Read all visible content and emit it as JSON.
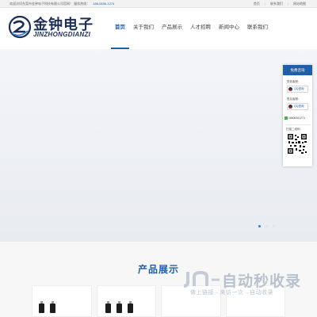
{
  "topbar": {
    "welcome": "欢迎访问东莞市金钟电子科技有限公司官网！",
    "hotline_label": "服务热线：",
    "hotline": "186-0636-1274",
    "links": [
      "首页",
      "联系我们",
      "网站地图"
    ]
  },
  "brand": {
    "name_cn": "金钟电子",
    "name_en": "JINZHONGDIANZI"
  },
  "nav": {
    "items": [
      {
        "label": "首页",
        "active": true
      },
      {
        "label": "关于我们",
        "active": false
      },
      {
        "label": "产品展示",
        "active": false
      },
      {
        "label": "人才招聘",
        "active": false
      },
      {
        "label": "新闻中心",
        "active": false
      },
      {
        "label": "联系我们",
        "active": false
      }
    ]
  },
  "banner": {
    "slide_count": 3,
    "active_slide": 1
  },
  "float_panel": {
    "header": "免费咨询",
    "presale_label": "售前客服：",
    "aftersale_label": "售后客服：",
    "qq_button": "QQ咨询",
    "phone": "18606361274",
    "scan_label": "扫描二维码："
  },
  "products": {
    "title": "产品展示"
  },
  "watermark": {
    "text": "自动秒收录",
    "subtext": "做上链接→来访一次→自动收录"
  },
  "colors": {
    "accent": "#1f5fa8",
    "brand_dark": "#1e2f55"
  }
}
